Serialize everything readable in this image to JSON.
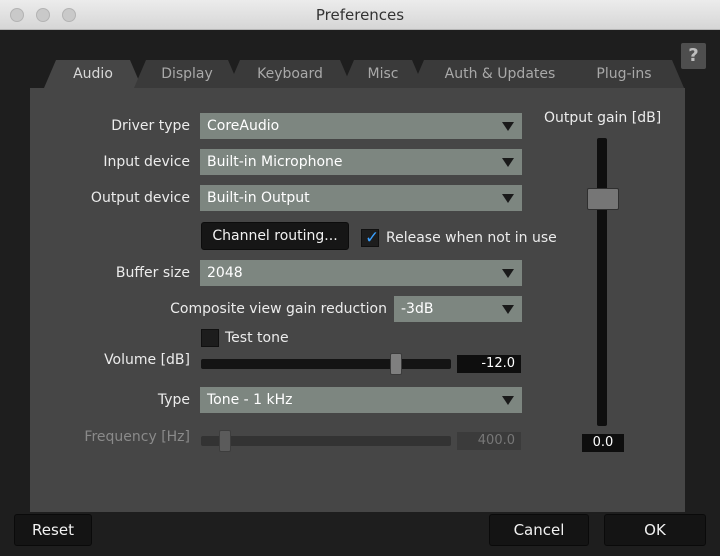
{
  "window": {
    "title": "Preferences"
  },
  "help": "?",
  "tabs": [
    "Audio",
    "Display",
    "Keyboard",
    "Misc",
    "Auth & Updates",
    "Plug-ins"
  ],
  "audio": {
    "driver_type": {
      "label": "Driver type",
      "value": "CoreAudio"
    },
    "input_device": {
      "label": "Input device",
      "value": "Built-in Microphone"
    },
    "output_device": {
      "label": "Output device",
      "value": "Built-in Output"
    },
    "channel_routing": "Channel routing...",
    "release_when_not_in_use": {
      "label": "Release when not in use",
      "checked": true
    },
    "buffer_size": {
      "label": "Buffer size",
      "value": "2048"
    },
    "composite_gain": {
      "label": "Composite view gain reduction",
      "value": "-3dB"
    },
    "test_tone": {
      "label": "Test tone",
      "checked": false
    },
    "volume": {
      "label": "Volume [dB]",
      "value": "-12.0"
    },
    "type": {
      "label": "Type",
      "value": "Tone - 1 kHz"
    },
    "frequency": {
      "label": "Frequency [Hz]",
      "value": "400.0"
    },
    "output_gain": {
      "label": "Output gain [dB]",
      "value": "0.0"
    }
  },
  "buttons": {
    "reset": "Reset",
    "cancel": "Cancel",
    "ok": "OK"
  },
  "colors": {
    "accent_check": "#3aa0ff",
    "select_bg": "#7d8680"
  }
}
